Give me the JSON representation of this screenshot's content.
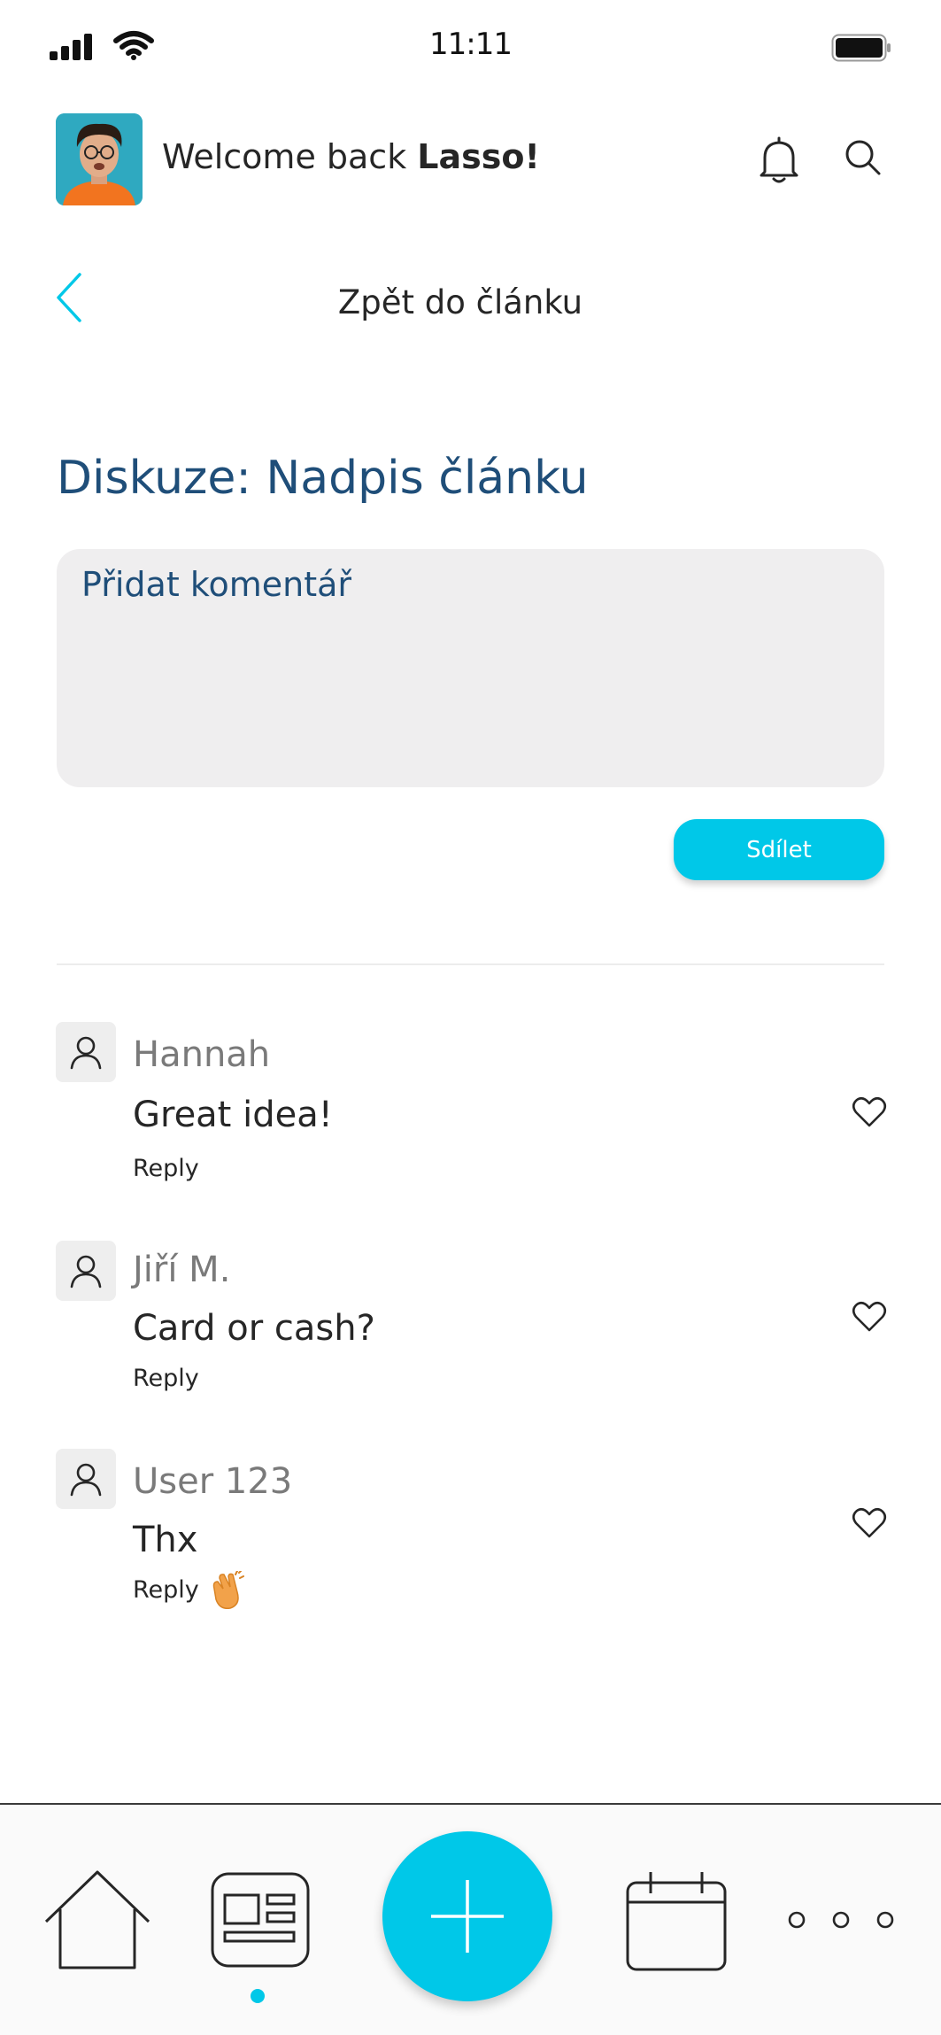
{
  "status_bar": {
    "time": "11:11"
  },
  "header": {
    "welcome_prefix": "Welcome back ",
    "user_name": "Lasso!"
  },
  "nav": {
    "back_title": "Zpět do článku"
  },
  "discussion": {
    "title": "Diskuze: Nadpis článku",
    "comment_placeholder": "Přidat komentář",
    "share_label": "Sdílet"
  },
  "comments": [
    {
      "author": "Hannah",
      "text": "Great idea!",
      "reply": "Reply"
    },
    {
      "author": "Jiří M.",
      "text": "Card or cash?",
      "reply": "Reply"
    },
    {
      "author": "User 123",
      "text": "Thx",
      "reply": "Reply"
    }
  ],
  "bottom_nav": {
    "items": [
      "home-icon",
      "news-icon",
      "add-icon",
      "calendar-icon",
      "more-icon"
    ],
    "active": "news-icon"
  },
  "colors": {
    "accent": "#00c8e8",
    "title_blue": "#1f4e79",
    "input_bg": "#efeeef"
  }
}
